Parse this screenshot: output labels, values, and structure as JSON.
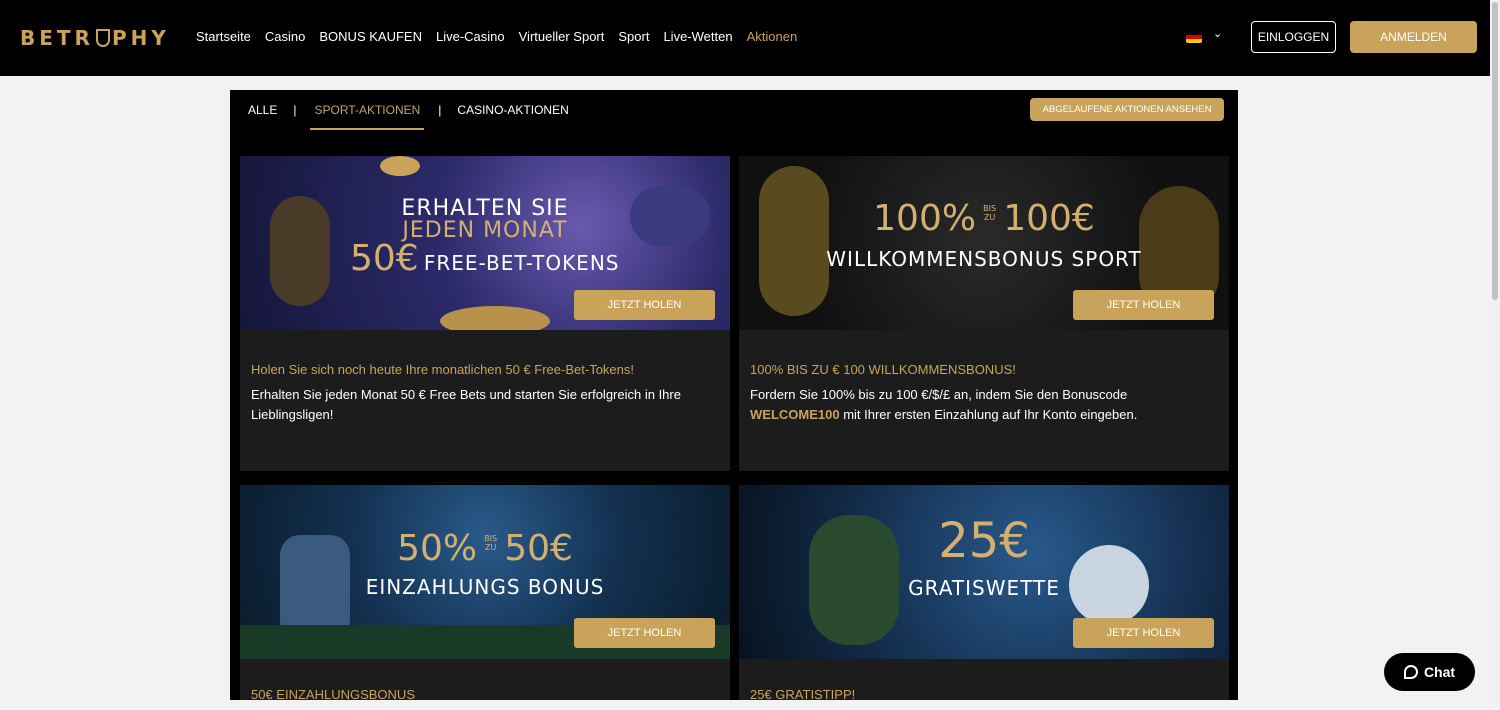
{
  "header": {
    "logo": "BETR PHY",
    "nav": [
      "Startseite",
      "Casino",
      "BONUS KAUFEN",
      "Live-Casino",
      "Virtueller Sport",
      "Sport",
      "Live-Wetten",
      "Aktionen"
    ],
    "active_nav": "Aktionen",
    "language_icon": "german-flag-icon",
    "login_label": "EINLOGGEN",
    "register_label": "ANMELDEN"
  },
  "tabs": {
    "items": [
      "ALLE",
      "SPORT-AKTIONEN",
      "CASINO-AKTIONEN"
    ],
    "active": "SPORT-AKTIONEN",
    "expired_label": "ABGELAUFENE AKTIONEN ANSEHEN"
  },
  "cards": [
    {
      "banner_line1": "ERHALTEN SIE",
      "banner_line2": "JEDEN MONAT",
      "banner_amount": "50€",
      "banner_line3": "FREE-BET-TOKENS",
      "button": "JETZT HOLEN",
      "heading": "Holen Sie sich noch heute Ihre monatlichen 50 € Free-Bet-Tokens!",
      "description": "Erhalten Sie jeden Monat 50 € Free Bets und starten Sie erfolgreich in Ihre Lieblingsligen!"
    },
    {
      "banner_pct": "100%",
      "banner_bis": "BIS",
      "banner_zu": "ZU",
      "banner_amount": "100€",
      "banner_line2": "WILLKOMMENSBONUS SPORT",
      "button": "JETZT HOLEN",
      "heading": "100% BIS ZU € 100 WILLKOMMENSBONUS!",
      "description_pre": "Fordern Sie 100% bis zu 100 €/$/£ an, indem Sie den Bonuscode ",
      "description_code": "WELCOME100",
      "description_post": " mit Ihrer ersten Einzahlung auf Ihr Konto eingeben."
    },
    {
      "banner_pct": "50%",
      "banner_bis": "BIS",
      "banner_zu": "ZU",
      "banner_amount": "50€",
      "banner_line2": "EINZAHLUNGS BONUS",
      "button": "JETZT HOLEN",
      "heading": "50€ EINZAHLUNGSBONUS"
    },
    {
      "banner_amount": "25€",
      "banner_line2": "GRATISWETTE",
      "button": "JETZT HOLEN",
      "heading": "25€ GRATISTIPP!"
    }
  ],
  "chat": {
    "label": "Chat",
    "icon": "chat-bubble-icon"
  },
  "colors": {
    "accent": "#c9a35a",
    "header_bg": "#000000",
    "card_bg": "#1c1c1c"
  }
}
